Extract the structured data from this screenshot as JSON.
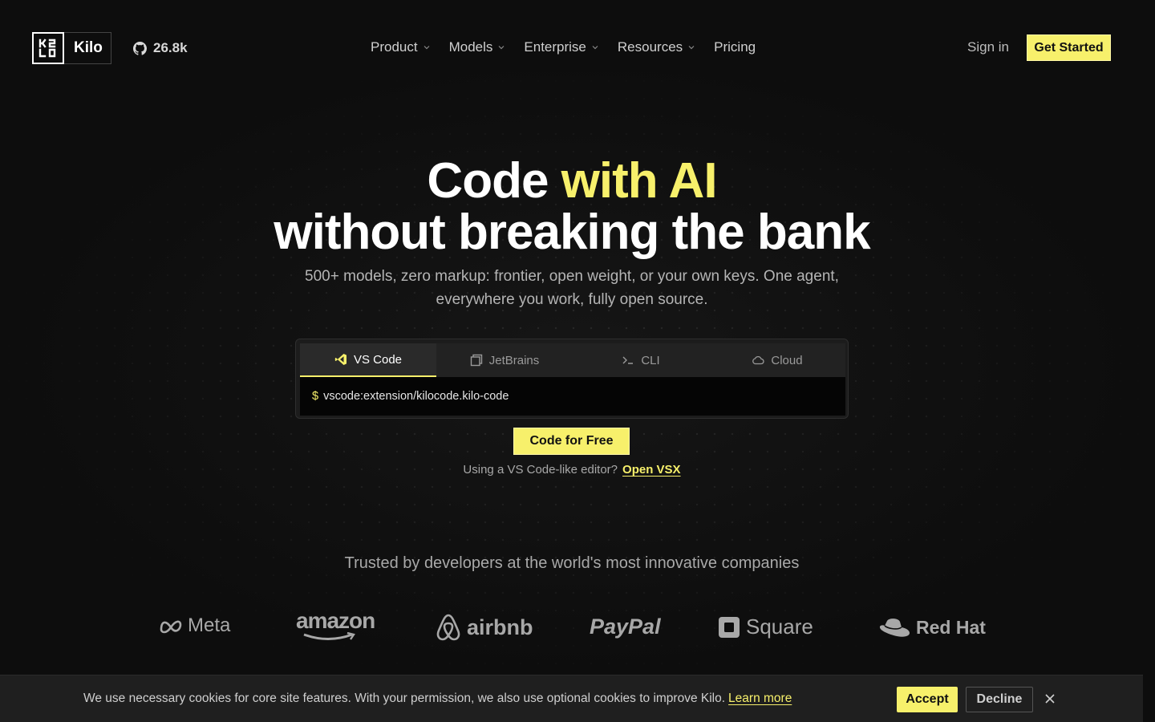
{
  "colors": {
    "accent": "#f7f06b",
    "background": "#0d0d0d"
  },
  "nav": {
    "logo_text": "Kilo",
    "github_stars": "26.8k",
    "menu": [
      {
        "label": "Product",
        "has_dropdown": true
      },
      {
        "label": "Models",
        "has_dropdown": true
      },
      {
        "label": "Enterprise",
        "has_dropdown": true
      },
      {
        "label": "Resources",
        "has_dropdown": true
      },
      {
        "label": "Pricing",
        "has_dropdown": false
      }
    ],
    "sign_in": "Sign in",
    "get_started": "Get Started"
  },
  "hero": {
    "title_line1_plain": "Code ",
    "title_line1_accent": "with AI",
    "title_line2": "without breaking the bank",
    "subtitle": "500+ models, zero markup: frontier, open weight, or your own keys. One agent, everywhere you work, fully open source."
  },
  "installer": {
    "tabs": [
      {
        "label": "VS Code",
        "icon": "vscode-icon",
        "active": true
      },
      {
        "label": "JetBrains",
        "icon": "jetbrains-icon",
        "active": false
      },
      {
        "label": "CLI",
        "icon": "terminal-icon",
        "active": false
      },
      {
        "label": "Cloud",
        "icon": "cloud-icon",
        "active": false
      }
    ],
    "prompt": "$",
    "command": "vscode:extension/kilocode.kilo-code"
  },
  "cta": {
    "label": "Code for Free",
    "vsx_text": "Using a VS Code-like editor?",
    "vsx_link": "Open VSX"
  },
  "trusted": {
    "heading": "Trusted by developers at the world's most innovative companies",
    "logos": [
      "Meta",
      "amazon",
      "airbnb",
      "PayPal",
      "Square",
      "Red Hat"
    ]
  },
  "cookie": {
    "text": "We use necessary cookies for core site features. With your permission, we also use optional cookies to improve Kilo.",
    "learn_more": "Learn more",
    "accept": "Accept",
    "decline": "Decline"
  }
}
